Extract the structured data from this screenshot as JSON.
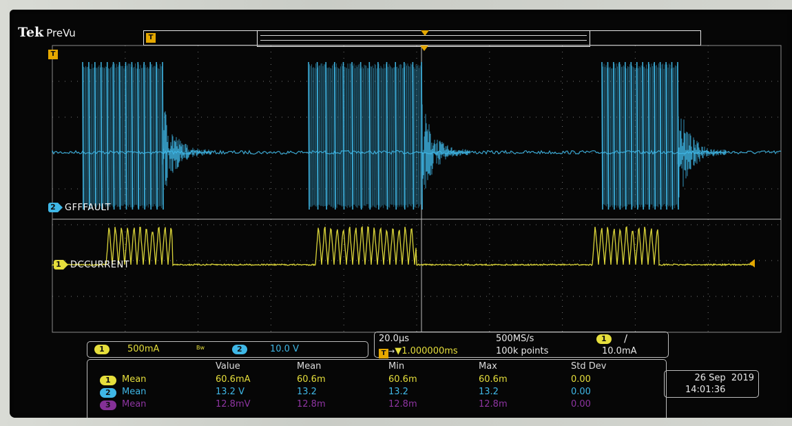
{
  "brand": {
    "name": "Tek",
    "state": "PreVu"
  },
  "colors": {
    "ch1": "#e6df3c",
    "ch2": "#3fb7e6",
    "ch3": "#a43bbb",
    "trigger": "#e5a800"
  },
  "markers": {
    "trigger_letter": "T"
  },
  "channels": [
    {
      "num": "2",
      "label": "GFFFAULT",
      "color": "#3fb7e6"
    },
    {
      "num": "1",
      "label": "DCCURRENT",
      "color": "#e6df3c"
    }
  ],
  "vertical": {
    "ch1": {
      "num": "1",
      "scale": "500mA",
      "bw": "Bw"
    },
    "ch2": {
      "num": "2",
      "scale": "10.0 V"
    }
  },
  "horizontal": {
    "timebase": "20.0µs",
    "delay": "▼1.000000ms",
    "delay_prefix": "T→",
    "sample_rate": "500MS/s",
    "record_length": "100k points",
    "trig_source": "1",
    "trig_slope": "∕",
    "trig_level": "10.0mA"
  },
  "measurements": {
    "headers": [
      "Value",
      "Mean",
      "Min",
      "Max",
      "Std Dev"
    ],
    "rows": [
      {
        "src": "1",
        "name": "Mean",
        "value": "60.6mA",
        "mean": "60.6m",
        "min": "60.6m",
        "max": "60.6m",
        "std": "0.00",
        "color": "yel"
      },
      {
        "src": "2",
        "name": "Mean",
        "value": "13.2 V",
        "mean": "13.2",
        "min": "13.2",
        "max": "13.2",
        "std": "0.00",
        "color": "cyn"
      },
      {
        "src": "3",
        "name": "Mean",
        "value": "12.8mV",
        "mean": "12.8m",
        "min": "12.8m",
        "max": "12.8m",
        "std": "0.00",
        "color": "mag"
      }
    ]
  },
  "datetime": {
    "date": "26 Sep  2019",
    "time": "14:01:36"
  }
}
